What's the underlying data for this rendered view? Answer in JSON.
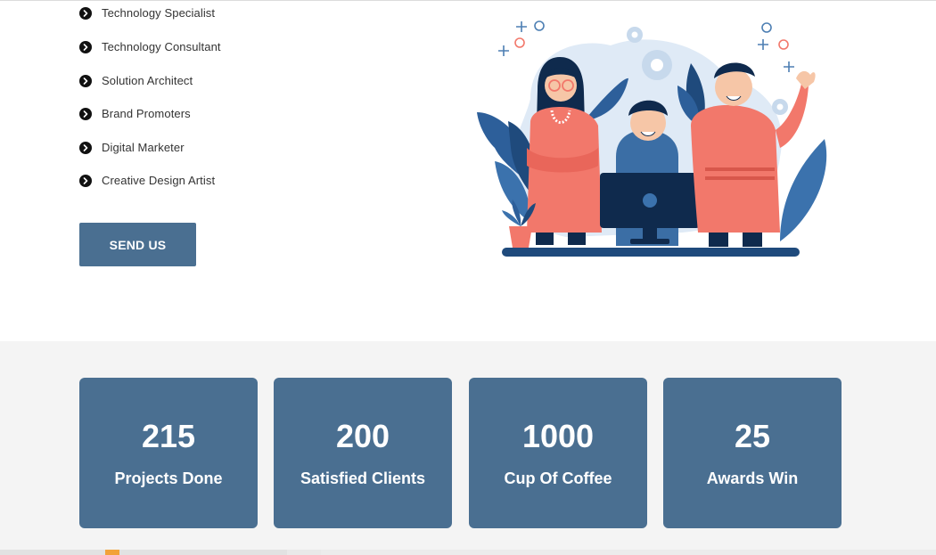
{
  "roles": [
    {
      "label": "Technology Specialist"
    },
    {
      "label": "Technology Consultant"
    },
    {
      "label": "Solution Architect"
    },
    {
      "label": "Brand Promoters"
    },
    {
      "label": "Digital Marketer"
    },
    {
      "label": "Creative Design Artist"
    }
  ],
  "cta": {
    "send_label": "SEND US"
  },
  "illustration": {
    "icon": "team-illustration"
  },
  "stats": [
    {
      "number": "215",
      "label": "Projects Done"
    },
    {
      "number": "200",
      "label": "Satisfied Clients"
    },
    {
      "number": "1000",
      "label": "Cup Of Coffee"
    },
    {
      "number": "25",
      "label": "Awards Win"
    }
  ],
  "colors": {
    "accent": "#4a6f91",
    "stats_background": "#f4f4f4",
    "bullet": "#111111",
    "illustration_blue": "#2d5f9a",
    "illustration_salmon": "#f2786b"
  }
}
